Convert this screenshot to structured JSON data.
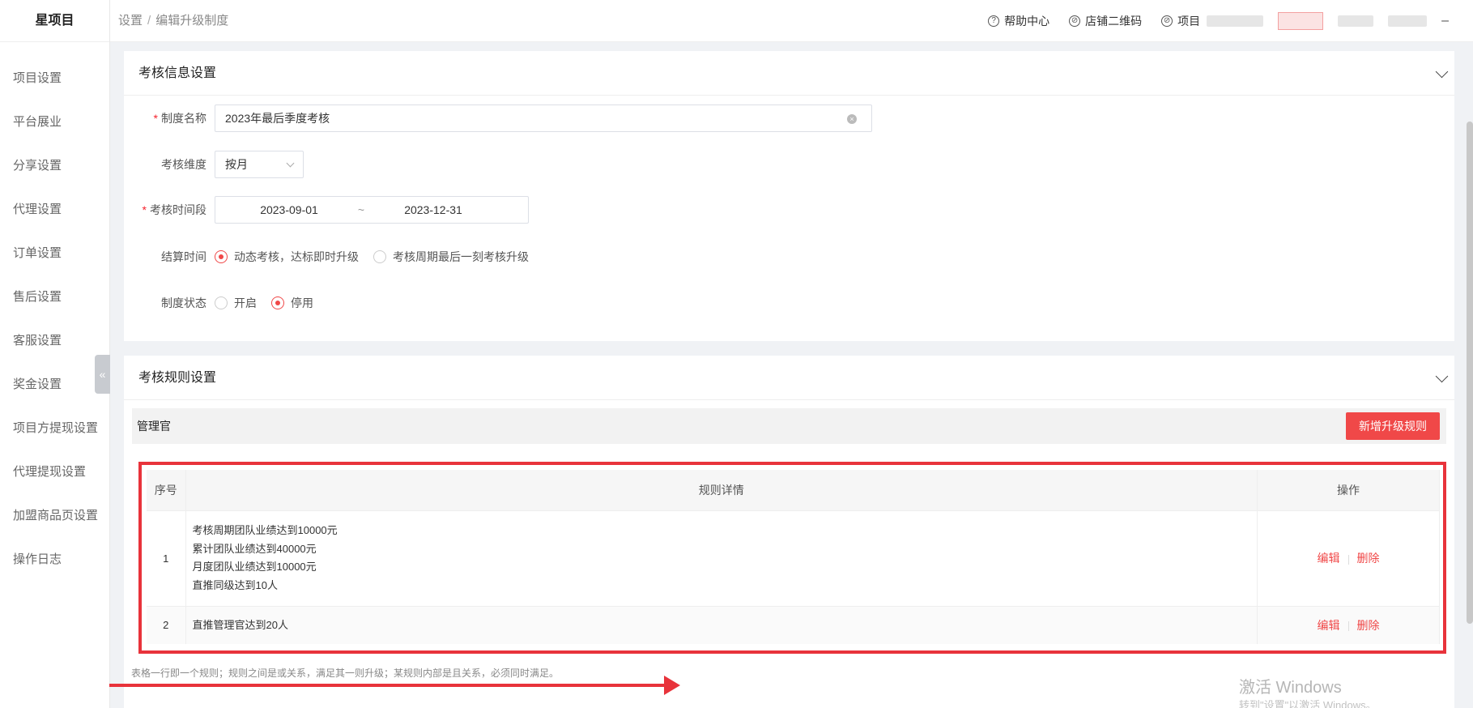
{
  "app": {
    "logo": "星项目"
  },
  "sidebar": {
    "items": [
      {
        "label": "项目设置"
      },
      {
        "label": "平台展业"
      },
      {
        "label": "分享设置"
      },
      {
        "label": "代理设置"
      },
      {
        "label": "订单设置"
      },
      {
        "label": "售后设置"
      },
      {
        "label": "客服设置"
      },
      {
        "label": "奖金设置"
      },
      {
        "label": "项目方提现设置"
      },
      {
        "label": "代理提现设置"
      },
      {
        "label": "加盟商品页设置"
      },
      {
        "label": "操作日志"
      }
    ],
    "collapse_glyph": "«"
  },
  "header": {
    "breadcrumb": [
      "设置",
      "编辑升级制度"
    ],
    "breadcrumb_sep": "/",
    "links": [
      {
        "label": "帮助中心",
        "icon": "?"
      },
      {
        "label": "店铺二维码",
        "icon": "⊘"
      },
      {
        "label": "项目",
        "icon": "⊘"
      }
    ],
    "minus": "–"
  },
  "section1": {
    "title": "考核信息设置",
    "name_label": "制度名称",
    "name_value": "2023年最后季度考核",
    "dimension_label": "考核维度",
    "dimension_value": "按月",
    "period_label": "考核时间段",
    "period_start": "2023-09-01",
    "period_sep": "~",
    "period_end": "2023-12-31",
    "settle_label": "结算时间",
    "settle_options": [
      "动态考核，达标即时升级",
      "考核周期最后一刻考核升级"
    ],
    "status_label": "制度状态",
    "status_options": [
      "开启",
      "停用"
    ]
  },
  "section2": {
    "title": "考核规则设置",
    "role": "管理官",
    "add_button": "新增升级规则",
    "table": {
      "headers": [
        "序号",
        "规则详情",
        "操作"
      ],
      "rows": [
        {
          "index": "1",
          "details": [
            "考核周期团队业绩达到10000元",
            "累计团队业绩达到40000元",
            "月度团队业绩达到10000元",
            "直推同级达到10人"
          ]
        },
        {
          "index": "2",
          "details": [
            "直推管理官达到20人"
          ]
        }
      ],
      "edit_label": "编辑",
      "delete_label": "删除"
    },
    "note": "表格一行即一个规则；规则之间是或关系，满足其一则升级；某规则内部是且关系，必须同时满足。"
  },
  "watermark": {
    "line1": "激活 Windows",
    "line2": "转到\"设置\"以激活 Windows。"
  },
  "colors": {
    "accent": "#f04848",
    "highlight": "#e8333b"
  }
}
